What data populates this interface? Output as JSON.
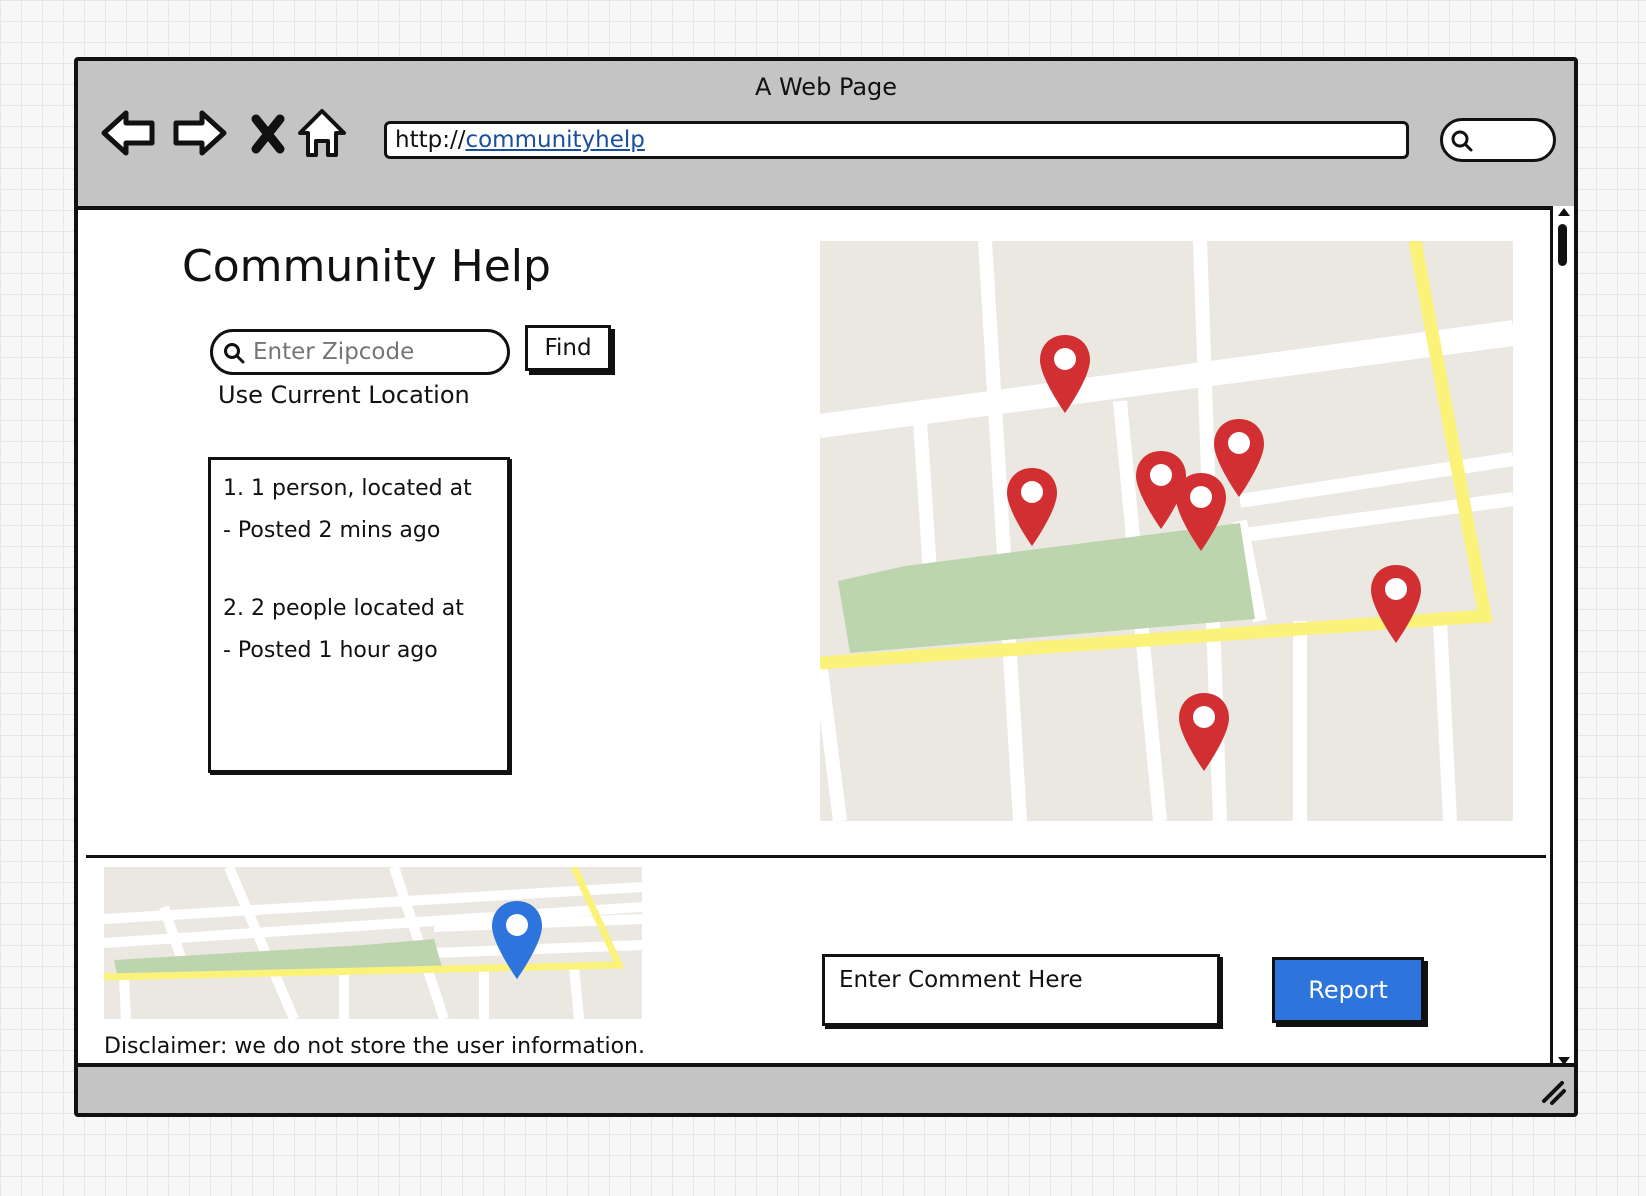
{
  "window": {
    "title": "A Web Page",
    "url_prefix": "http://",
    "url_link": "communityhelp"
  },
  "page": {
    "heading": "Community Help",
    "zip_placeholder": "Enter Zipcode",
    "find_label": "Find",
    "use_location_label": "Use Current Location",
    "results": [
      {
        "title": "1. 1 person, located at",
        "posted": "- Posted 2 mins ago"
      },
      {
        "title": "2. 2 people located at",
        "posted": "- Posted 1 hour ago"
      }
    ],
    "disclaimer": "Disclaimer: we do not store the user information.",
    "comment_placeholder": "Enter Comment Here",
    "report_label": "Report"
  },
  "colors": {
    "pin_red": "#d12f32",
    "pin_blue": "#2d74dd",
    "road_yellow": "#fbf27a",
    "park_green": "#bdd5ae",
    "map_bg": "#ebe8e1",
    "report_button": "#2d74dd"
  }
}
